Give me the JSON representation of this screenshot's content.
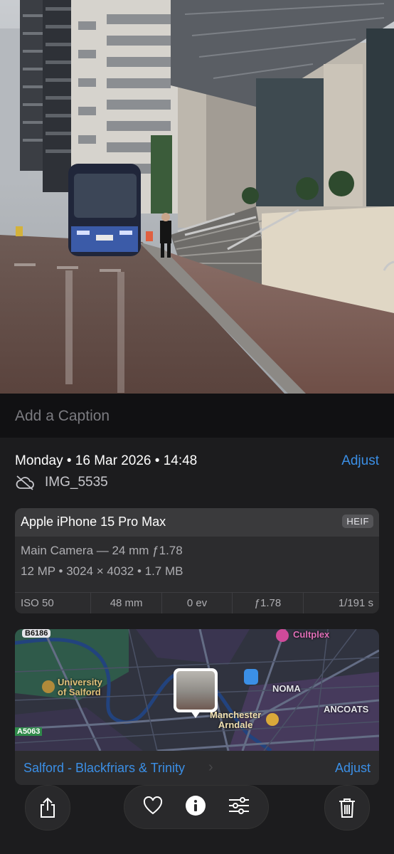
{
  "caption": {
    "placeholder": "Add a Caption"
  },
  "info": {
    "date": "Monday • 16 Mar 2026 • 14:48",
    "adjust_label": "Adjust",
    "filename": "IMG_5535"
  },
  "camera": {
    "device": "Apple iPhone 15 Pro Max",
    "format": "HEIF",
    "lens": "Main Camera — 24 mm ƒ1.78",
    "specs": "12 MP • 3024 × 4032 • 1.7 MB",
    "exif": [
      "ISO 50",
      "48 mm",
      "0 ev",
      "ƒ1.78",
      "1/191 s"
    ]
  },
  "map": {
    "labels": {
      "road_b6186": "B6186",
      "cultplex": "Cultplex",
      "university": "University\nof Salford",
      "noma": "NOMA",
      "ancoats": "ANCOATS",
      "manchester": "Manchester\nArndale",
      "road_a5063": "A5063"
    },
    "location_name": "Salford - Blackfriars & Trinity",
    "adjust_label": "Adjust"
  },
  "toolbar": {
    "share": "share-icon",
    "favorite": "heart-icon",
    "info": "info-icon",
    "edit": "sliders-icon",
    "delete": "trash-icon"
  },
  "colors": {
    "accent": "#3b8fe6",
    "sheet": "#1c1c1e",
    "card": "#2c2c2e"
  }
}
